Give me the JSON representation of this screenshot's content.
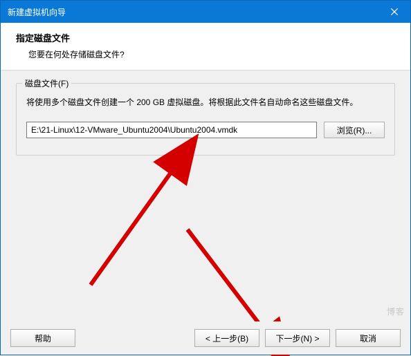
{
  "titlebar": {
    "title": "新建虚拟机向导"
  },
  "header": {
    "heading": "指定磁盘文件",
    "subheading": "您要在何处存储磁盘文件?"
  },
  "group": {
    "legend": "磁盘文件(F)",
    "description": "将使用多个磁盘文件创建一个 200 GB 虚拟磁盘。将根据此文件名自动命名这些磁盘文件。",
    "path_value": "E:\\21-Linux\\12-VMware_Ubuntu2004\\Ubuntu2004.vmdk",
    "browse_label": "浏览(R)..."
  },
  "footer": {
    "help_label": "帮助",
    "back_label": "< 上一步(B)",
    "next_label": "下一步(N) >",
    "cancel_label": "取消"
  },
  "watermark": "博客"
}
